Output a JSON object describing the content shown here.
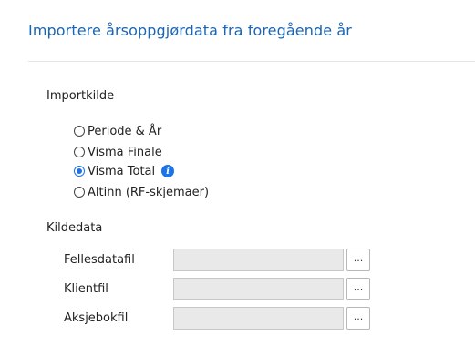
{
  "dialog": {
    "title": "Importere årsoppgjørdata fra foregående år"
  },
  "import_source": {
    "label": "Importkilde",
    "options": [
      {
        "label": "Periode & År",
        "selected": false
      },
      {
        "label": "Visma Finale",
        "selected": false
      },
      {
        "label": "Visma Total",
        "selected": true,
        "has_info": true
      },
      {
        "label": "Altinn (RF-skjemaer)",
        "selected": false
      }
    ]
  },
  "source_data": {
    "label": "Kildedata",
    "fields": [
      {
        "label": "Fellesdatafil",
        "value": "",
        "button_label": "..."
      },
      {
        "label": "Klientfil",
        "value": "",
        "button_label": "..."
      },
      {
        "label": "Aksjebokfil",
        "value": "",
        "button_label": "..."
      }
    ]
  },
  "colors": {
    "title": "#1c64b4",
    "accent": "#1a73e8",
    "input_bg": "#e9e9e9"
  },
  "icons": {
    "info": "info-icon"
  }
}
